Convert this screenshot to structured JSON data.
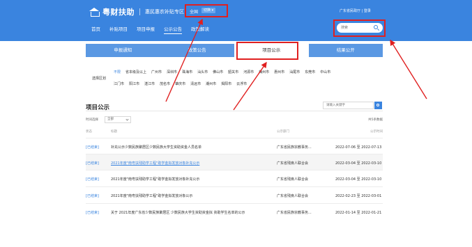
{
  "header": {
    "logo_text": "粤财扶助",
    "subtitle": "惠民惠农补贴专区",
    "region_name": "全国",
    "region_tag": "切换 ▾",
    "right_links": "广东省民政厅  |  登录",
    "nav": [
      "首页",
      "补贴项目",
      "项目申报",
      "公示公告",
      "政策解读"
    ],
    "search_placeholder": "搜索"
  },
  "tabs": [
    "申报通知",
    "政策公告",
    "项目公示",
    "结果公开"
  ],
  "region_filter": {
    "label": "选择区划",
    "row1": [
      "不限",
      "省本级及以上",
      "广州市",
      "深圳市",
      "珠海市",
      "汕头市",
      "佛山市",
      "韶关市",
      "河源市",
      "梅州市",
      "惠州市",
      "汕尾市",
      "东莞市",
      "中山市"
    ],
    "row2": [
      "江门市",
      "阳江市",
      "湛江市",
      "茂名市",
      "肇庆市",
      "清远市",
      "潮州市",
      "揭阳市",
      "云浮市"
    ]
  },
  "list": {
    "section_title": "项目公示",
    "search_placeholder": "请输入关键字",
    "filter_label": "时间选择",
    "filter_value": "全部",
    "total": "共5条数据",
    "columns": [
      "状态",
      "标题",
      "公示部门",
      "公示时间"
    ],
    "rows": [
      {
        "status": "[已结束]",
        "title": "补充公示少数民族聚居区少数民族大学生资助资金人员名单",
        "dept": "广东省民族宗教事务...",
        "date": "2022-07-06 至 2022-07-13",
        "link": false
      },
      {
        "status": "[已结束]",
        "title": "2021年度\"南粤扶残助学工程\"助学金拟发放对象补充公示",
        "dept": "广东省残疾人联合会",
        "date": "2022-03-04 至 2022-03-10",
        "link": true
      },
      {
        "status": "[已结束]",
        "title": "2021年度\"南粤扶残助学工程\"助学金拟发放对象补充公示",
        "dept": "广东省残疾人联合会",
        "date": "2022-03-04 至 2022-03-10",
        "link": false
      },
      {
        "status": "[已结束]",
        "title": "2021年度\"南粤扶残助学工程\"助学金拟发放对象公示",
        "dept": "广东省残疾人联合会",
        "date": "2022-02-23 至 2022-03-01",
        "link": false
      },
      {
        "status": "[已结束]",
        "title": "关于 2021年度广东省少数民族聚居区 少数民族大学生资助资金拟 资助学生名单的公示",
        "dept": "广东省民族宗教事务...",
        "date": "2022-01-14 至 2022-01-21",
        "link": false
      }
    ]
  },
  "colors": {
    "brand": "#3a84df",
    "tab_bar": "#5a98e3",
    "annotation": "#e02020"
  }
}
